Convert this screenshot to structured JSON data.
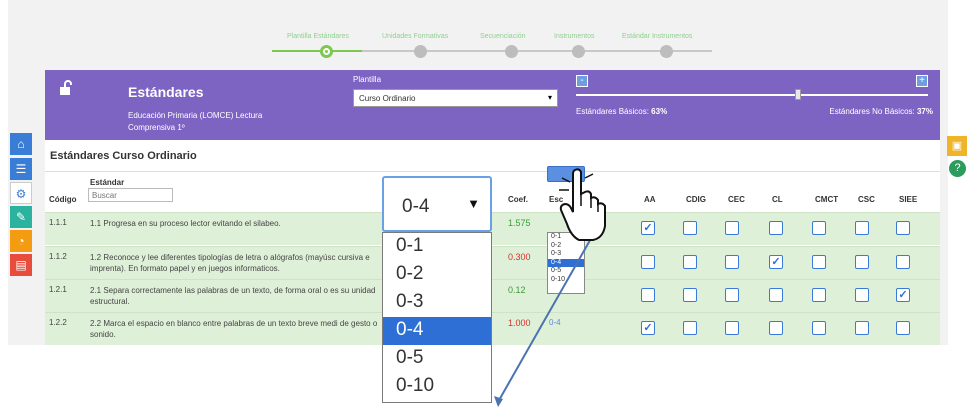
{
  "wizard": {
    "steps": [
      "Plantilla Estándares",
      "Unidades Formativas",
      "Secuenciación",
      "Instrumentos",
      "Estándar Instrumentos"
    ],
    "active_index": 0
  },
  "header": {
    "title": "Estándares",
    "subtitle": "Educación Primaria (LOMCE) Lectura Comprensiva 1º",
    "plantilla_label": "Plantilla",
    "plantilla_value": "Curso Ordinario",
    "basicos_label": "Estándares Básicos:",
    "basicos_value": "63%",
    "nobasicos_label": "Estándares No Básicos:",
    "nobasicos_value": "37%",
    "slider_level": 0.63,
    "minus": "-",
    "plus": "+"
  },
  "section": {
    "title": "Estándares Curso Ordinario",
    "columns": {
      "codigo": "Código",
      "estandar": "Estándar",
      "coef": "Coef.",
      "esc": "Esc",
      "aa": "AA",
      "cdig": "CDIG",
      "cec": "CEC",
      "cl": "CL",
      "cmct": "CMCT",
      "csc": "CSC",
      "siee": "SIEE"
    },
    "search_placeholder": "Buscar"
  },
  "rows": [
    {
      "code": "1.1.1",
      "text": "1.1 Progresa en su proceso lector evitando el silabeo.",
      "coef": "1.575",
      "coef_color": "#3c9a3c",
      "esc": "",
      "checks": [
        true,
        false,
        false,
        false,
        false,
        false,
        false
      ]
    },
    {
      "code": "1.1.2",
      "text": "1.2 Reconoce y lee diferentes tipologías de letra o alógrafos (mayúsc cursiva e imprenta). En formato papel y en juegos informaticos.",
      "coef": "0.300",
      "coef_color": "#d9302c",
      "esc": "",
      "checks": [
        false,
        false,
        false,
        true,
        false,
        false,
        false
      ]
    },
    {
      "code": "1.2.1",
      "text": "2.1 Separa correctamente las palabras de un texto, de forma oral o es su unidad estructural.",
      "coef": "0.12",
      "coef_color": "#3c9a3c",
      "esc": "",
      "checks": [
        false,
        false,
        false,
        false,
        false,
        false,
        true
      ]
    },
    {
      "code": "1.2.2",
      "text": "2.2 Marca el espacio en blanco entre palabras de un texto breve medi de gesto o sonido.",
      "coef": "1.000",
      "coef_color": "#d9302c",
      "esc": "0-4",
      "checks": [
        true,
        false,
        false,
        false,
        false,
        false,
        false
      ]
    }
  ],
  "big_dropdown": {
    "selected": "0-4",
    "options": [
      "0-1",
      "0-2",
      "0-3",
      "0-4",
      "0-5",
      "0-10"
    ]
  },
  "small_dropdown": {
    "options": [
      "0-1",
      "0-2",
      "0-3",
      "0-4",
      "0-5",
      "0-10"
    ],
    "selected": "0-4"
  },
  "icons": {
    "lock": "unlock-icon",
    "sidebar": [
      "home-icon",
      "list-icon",
      "cogs-icon",
      "edit-icon",
      "pie-chart-icon",
      "file-icon"
    ],
    "right": [
      "save-icon",
      "help-icon"
    ],
    "cursor": "hand-pointer-icon"
  },
  "colors": {
    "header": "#7e64c2",
    "row_bg": "#dff0d8",
    "accent_green": "#7dc850",
    "checkbox_blue": "#2d6fd4"
  }
}
